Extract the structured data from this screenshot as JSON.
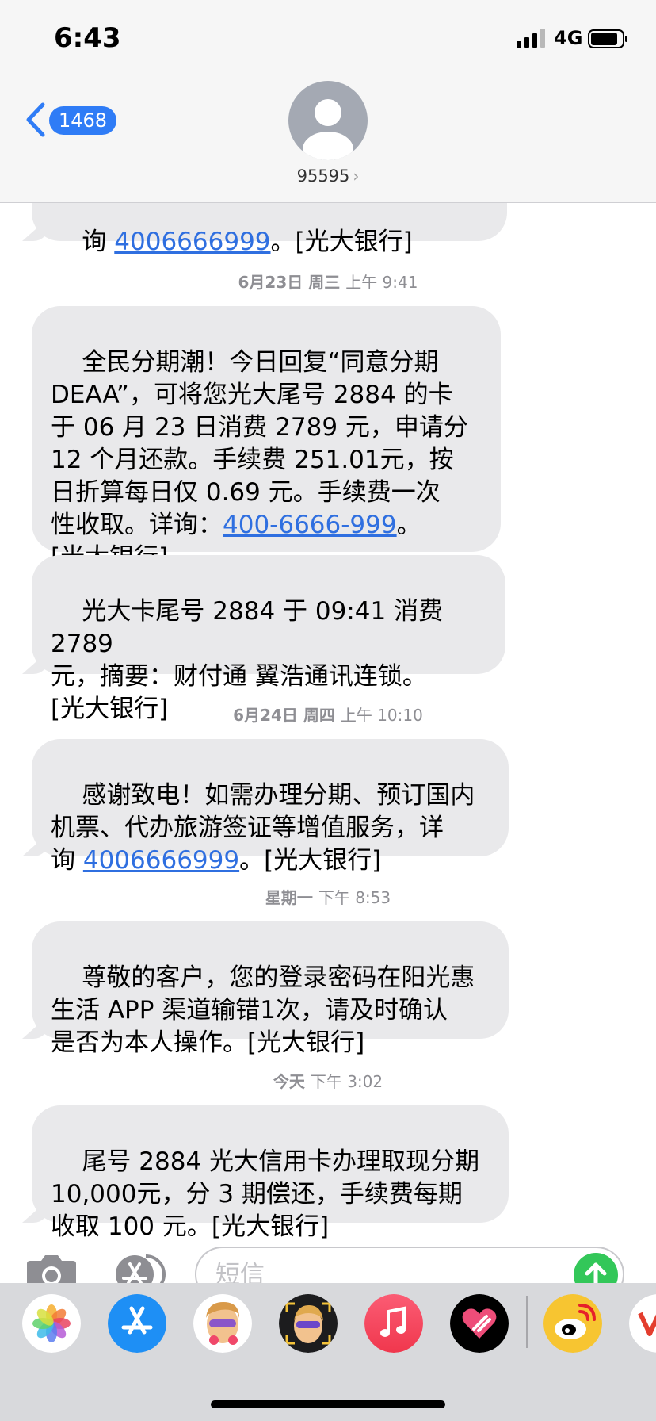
{
  "status_bar": {
    "time": "6:43",
    "network": "4G"
  },
  "header": {
    "back_count": "1468",
    "contact_name": "95595",
    "contact_chevron": "›"
  },
  "messages": [
    {
      "parts": [
        "询 ",
        "4006666999",
        "。[光大银行]"
      ]
    },
    {
      "timestamp_day": "6月23日 周三",
      "timestamp_time": "上午 9:41"
    },
    {
      "parts": [
        "全民分期潮！今日回复“同意分期\nDEAA”，可将您光大尾号 2884 的卡\n于 06 月 23 日消费 2789 元，申请分\n12 个月还款。手续费 251.01元，按\n日折算每日仅 0.69 元。手续费一次\n性收取。详询：",
        "400-6666-999",
        "。\n[光大银行]"
      ]
    },
    {
      "parts": [
        "光大卡尾号 2884 于 09:41 消费 2789\n元，摘要：财付通 翼浩通讯连锁。\n[光大银行]"
      ]
    },
    {
      "timestamp_day": "6月24日 周四",
      "timestamp_time": "上午 10:10"
    },
    {
      "parts": [
        "感谢致电！如需办理分期、预订国内\n机票、代办旅游签证等增值服务，详\n询 ",
        "4006666999",
        "。[光大银行]"
      ]
    },
    {
      "timestamp_day": "星期一",
      "timestamp_time": "下午 8:53"
    },
    {
      "parts": [
        "尊敬的客户，您的登录密码在阳光惠\n生活 APP 渠道输错1次，请及时确认\n是否为本人操作。[光大银行]"
      ]
    },
    {
      "timestamp_day": "今天",
      "timestamp_time": "下午 3:02"
    },
    {
      "parts": [
        "尾号 2884 光大信用卡办理取现分期\n10,000元，分 3 期偿还，手续费每期\n收取 100 元。[光大银行]"
      ]
    }
  ],
  "input": {
    "placeholder": "短信"
  },
  "icons": {
    "camera": "camera-icon",
    "appstore": "app-store-icon",
    "send": "arrow-up-icon",
    "apps": [
      "photos-icon",
      "app-store-icon",
      "memoji-icon",
      "animoji-icon",
      "music-icon",
      "digital-touch-icon",
      "weibo-icon",
      "app-icon"
    ]
  },
  "colors": {
    "bubble": "#e9e9eb",
    "link": "#2f6fe0",
    "badge": "#2f7cf6",
    "send": "#33c759"
  }
}
